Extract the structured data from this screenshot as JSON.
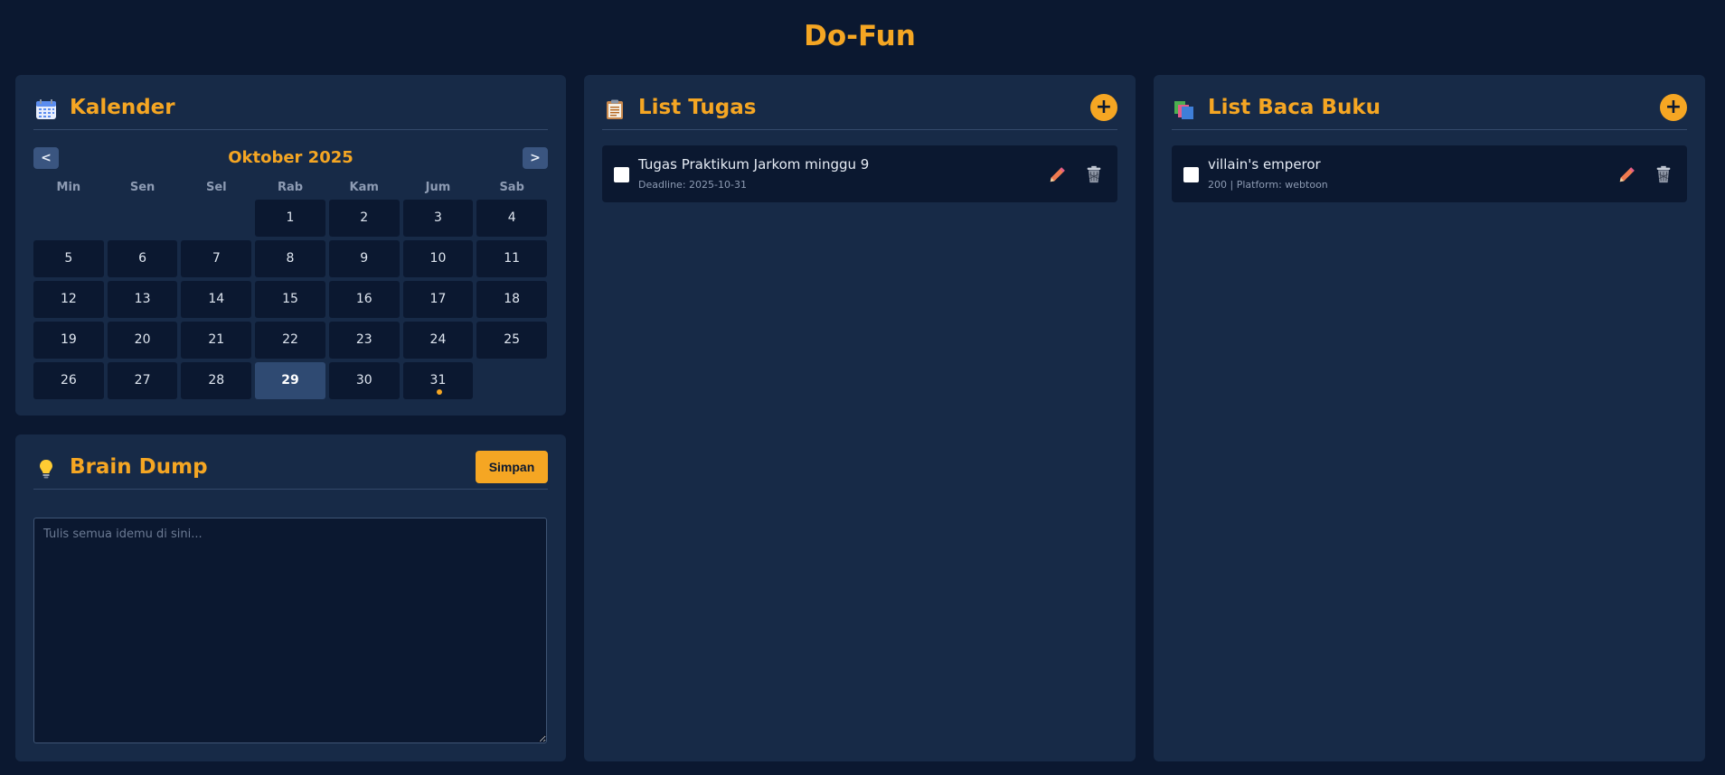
{
  "app": {
    "title": "Do-Fun"
  },
  "calendar": {
    "title": "Kalender",
    "month_label": "Oktober 2025",
    "prev_label": "<",
    "next_label": ">",
    "weekdays": [
      "Min",
      "Sen",
      "Sel",
      "Rab",
      "Kam",
      "Jum",
      "Sab"
    ],
    "weeks": [
      [
        "",
        "",
        "",
        "1",
        "2",
        "3",
        "4"
      ],
      [
        "5",
        "6",
        "7",
        "8",
        "9",
        "10",
        "11"
      ],
      [
        "12",
        "13",
        "14",
        "15",
        "16",
        "17",
        "18"
      ],
      [
        "19",
        "20",
        "21",
        "22",
        "23",
        "24",
        "25"
      ],
      [
        "26",
        "27",
        "28",
        "29",
        "30",
        "31",
        ""
      ]
    ],
    "today": "29",
    "event_days": [
      "31"
    ]
  },
  "brain_dump": {
    "title": "Brain Dump",
    "save_label": "Simpan",
    "placeholder": "Tulis semua idemu di sini...",
    "value": ""
  },
  "tasks": {
    "title": "List Tugas",
    "add_label": "+",
    "items": [
      {
        "title": "Tugas Praktikum Jarkom minggu 9",
        "subtitle": "Deadline: 2025-10-31"
      }
    ]
  },
  "books": {
    "title": "List Baca Buku",
    "add_label": "+",
    "items": [
      {
        "title": "villain's emperor",
        "subtitle": "200 | Platform: webtoon"
      }
    ]
  },
  "colors": {
    "accent": "#f5a623",
    "background": "#0b1830",
    "panel": "#172a47",
    "today_cell": "#2f4a72",
    "edit_icon": "#f07b50"
  },
  "icons": [
    "calendar-icon",
    "lightbulb-icon",
    "clipboard-icon",
    "books-icon",
    "pencil-icon",
    "trash-icon"
  ]
}
